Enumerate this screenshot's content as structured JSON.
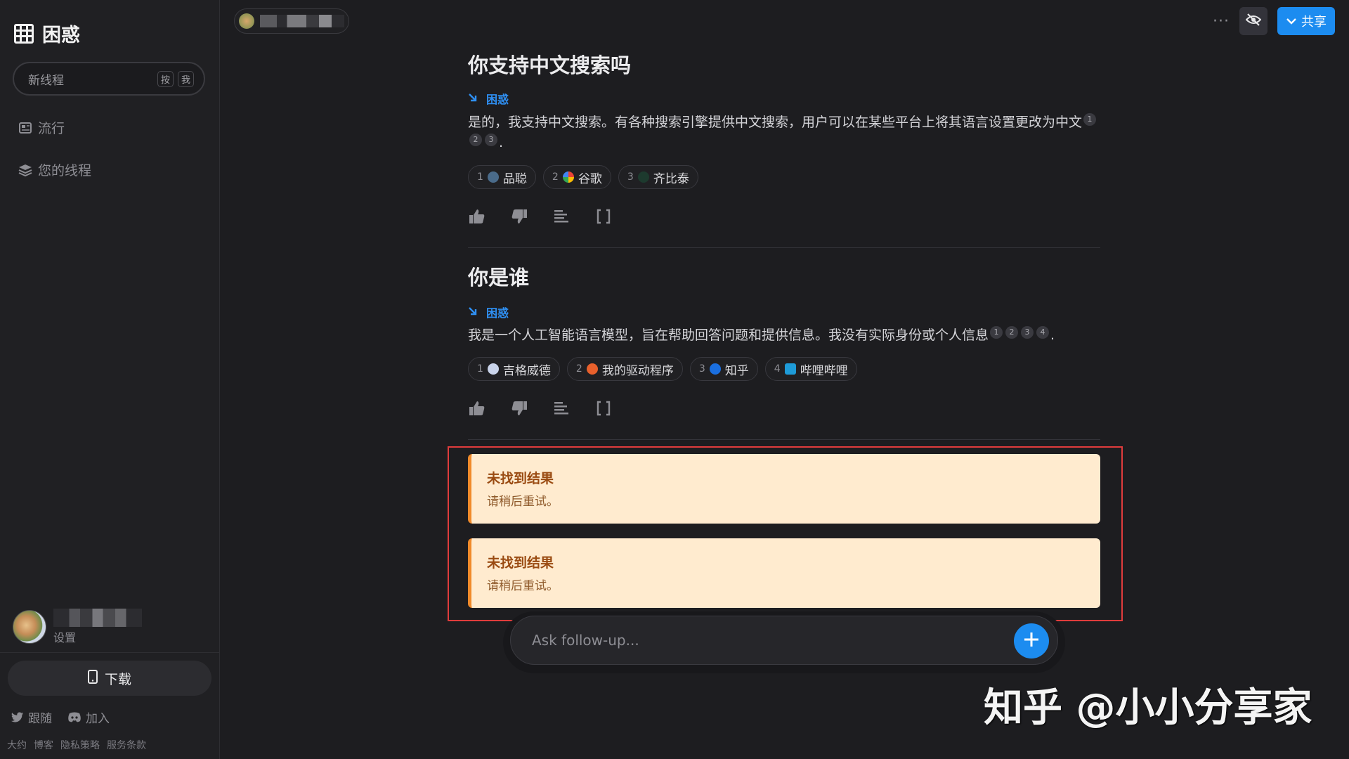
{
  "sidebar": {
    "app_name": "困惑",
    "new_thread": {
      "label": "新线程",
      "keys": [
        "按",
        "我"
      ]
    },
    "nav": [
      {
        "label": "流行",
        "icon": "newspaper-icon"
      },
      {
        "label": "您的线程",
        "icon": "layers-icon"
      }
    ],
    "user": {
      "settings_label": "设置"
    },
    "download_label": "下载",
    "social": [
      {
        "label": "跟随",
        "icon": "twitter-icon"
      },
      {
        "label": "加入",
        "icon": "discord-icon"
      }
    ],
    "footer_links": [
      "大约",
      "博客",
      "隐私策略",
      "服务条款"
    ]
  },
  "topbar": {
    "more_icon": "more-icon",
    "visibility_icon": "eye-off-icon",
    "share_label": "共享"
  },
  "threads": [
    {
      "question": "你支持中文搜索吗",
      "source_tag": "困惑",
      "answer": "是的，我支持中文搜索。有各种搜索引擎提供中文搜索，用户可以在某些平台上将其语言设置更改为中文",
      "citations": [
        "1",
        "2",
        "3"
      ],
      "answer_end": ".",
      "sources": [
        {
          "num": "1",
          "name": "品聪"
        },
        {
          "num": "2",
          "name": "谷歌"
        },
        {
          "num": "3",
          "name": "齐比泰"
        }
      ]
    },
    {
      "question": "你是谁",
      "source_tag": "困惑",
      "answer": "我是一个人工智能语言模型，旨在帮助回答问题和提供信息。我没有实际身份或个人信息",
      "citations": [
        "1",
        "2",
        "3",
        "4"
      ],
      "answer_end": ".",
      "sources": [
        {
          "num": "1",
          "name": "吉格威德"
        },
        {
          "num": "2",
          "name": "我的驱动程序"
        },
        {
          "num": "3",
          "name": "知乎"
        },
        {
          "num": "4",
          "name": "哔哩哔哩"
        }
      ]
    }
  ],
  "errors": [
    {
      "title": "未找到结果",
      "detail": "请稍后重试。"
    },
    {
      "title": "未找到结果",
      "detail": "请稍后重试。"
    }
  ],
  "followup": {
    "placeholder": "Ask follow-up..."
  },
  "watermark": "知乎 @小小分享家",
  "colors": {
    "accent": "#1c8cf0",
    "warning_bg": "#ffebcf",
    "warning_border": "#f08a2a",
    "highlight_box": "#e03c3c"
  }
}
